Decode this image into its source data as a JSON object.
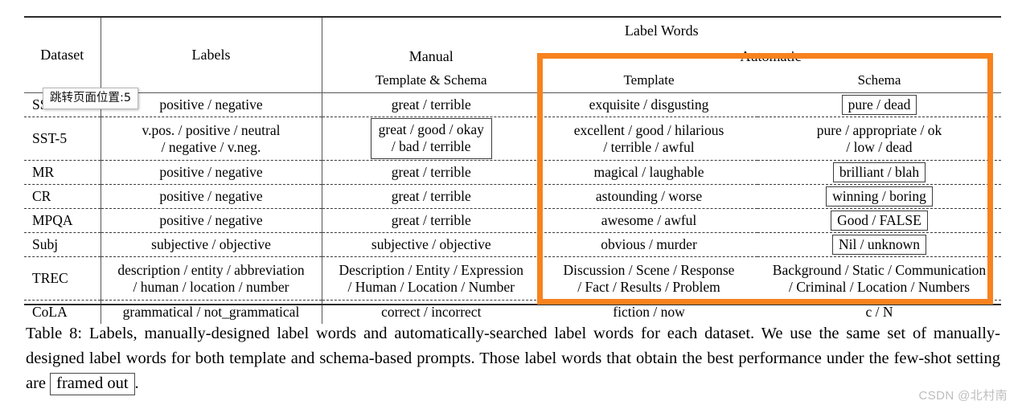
{
  "table": {
    "label_words_group": "Label Words",
    "columns": {
      "dataset": "Dataset",
      "labels": "Labels",
      "manual": "Manual",
      "manual_sub": "Template & Schema",
      "automatic": "Automatic",
      "auto_template": "Template",
      "auto_schema": "Schema"
    },
    "rows": [
      {
        "dataset": "SST-2",
        "labels": [
          "positive / negative"
        ],
        "manual": [
          "great / terrible"
        ],
        "manual_framed": false,
        "auto_template": [
          "exquisite / disgusting"
        ],
        "auto_template_framed": false,
        "auto_schema": [
          "pure / dead"
        ],
        "auto_schema_framed": true
      },
      {
        "dataset": "SST-5",
        "labels": [
          "v.pos. / positive / neutral",
          "/ negative / v.neg."
        ],
        "manual": [
          "great / good / okay",
          "/ bad / terrible"
        ],
        "manual_framed": true,
        "auto_template": [
          "excellent / good / hilarious",
          "/ terrible / awful"
        ],
        "auto_template_framed": false,
        "auto_schema": [
          "pure / appropriate / ok",
          "/ low / dead"
        ],
        "auto_schema_framed": false
      },
      {
        "dataset": "MR",
        "labels": [
          "positive / negative"
        ],
        "manual": [
          "great / terrible"
        ],
        "manual_framed": false,
        "auto_template": [
          "magical / laughable"
        ],
        "auto_template_framed": false,
        "auto_schema": [
          "brilliant / blah"
        ],
        "auto_schema_framed": true
      },
      {
        "dataset": "CR",
        "labels": [
          "positive / negative"
        ],
        "manual": [
          "great / terrible"
        ],
        "manual_framed": false,
        "auto_template": [
          "astounding / worse"
        ],
        "auto_template_framed": false,
        "auto_schema": [
          "winning / boring"
        ],
        "auto_schema_framed": true
      },
      {
        "dataset": "MPQA",
        "labels": [
          "positive / negative"
        ],
        "manual": [
          "great / terrible"
        ],
        "manual_framed": false,
        "auto_template": [
          "awesome / awful"
        ],
        "auto_template_framed": false,
        "auto_schema": [
          "Good / FALSE"
        ],
        "auto_schema_framed": true
      },
      {
        "dataset": "Subj",
        "labels": [
          "subjective / objective"
        ],
        "manual": [
          "subjective / objective"
        ],
        "manual_framed": false,
        "auto_template": [
          "obvious / murder"
        ],
        "auto_template_framed": false,
        "auto_schema": [
          "Nil / unknown"
        ],
        "auto_schema_framed": true
      },
      {
        "dataset": "TREC",
        "labels": [
          "description / entity / abbreviation",
          "/ human / location / number"
        ],
        "manual": [
          "Description / Entity / Expression",
          "/ Human / Location / Number"
        ],
        "manual_framed": false,
        "auto_template": [
          "Discussion / Scene / Response",
          "/ Fact / Results / Problem"
        ],
        "auto_template_framed": false,
        "auto_schema": [
          "Background / Static / Communication",
          "/ Criminal / Location / Numbers"
        ],
        "auto_schema_framed": false
      },
      {
        "dataset": "CoLA",
        "labels": [
          "grammatical / not_grammatical"
        ],
        "manual": [
          "correct / incorrect"
        ],
        "manual_framed": false,
        "auto_template": [
          "fiction / now"
        ],
        "auto_template_framed": false,
        "auto_schema": [
          "c / N"
        ],
        "auto_schema_framed": false
      }
    ]
  },
  "caption": {
    "part1": "Table 8: Labels, manually-designed label words and automatically-searched label words for each dataset. We use the same set of manually-designed label words for both template and schema-based prompts. Those label words that obtain the best performance under the few-shot setting are",
    "framed_text": "framed out",
    "part2": "."
  },
  "overlay": {
    "tooltip_text": "跳转页面位置:5"
  },
  "watermark": {
    "text": "CSDN @北村南"
  },
  "colors": {
    "highlight": "#F7821E",
    "rule": "#2b2b2b",
    "watermark": "#bdbdbd"
  }
}
